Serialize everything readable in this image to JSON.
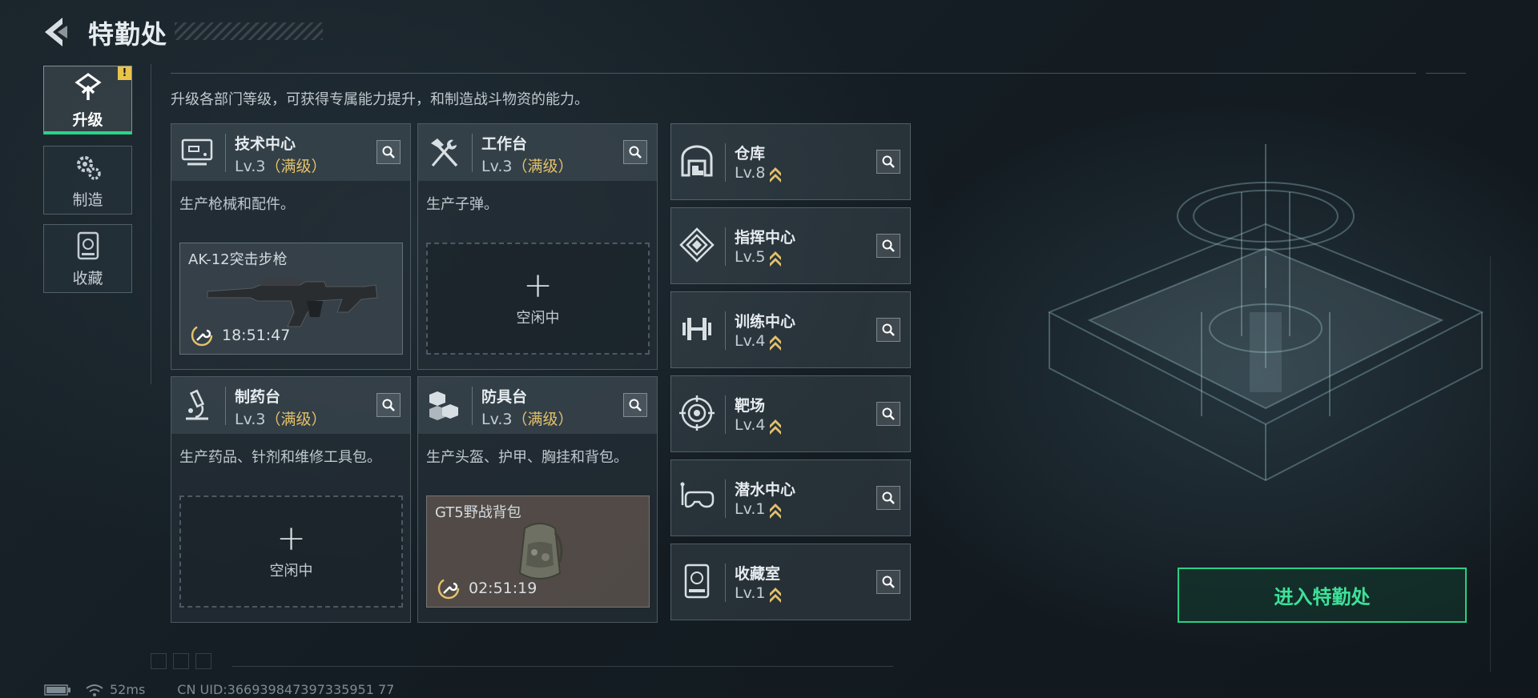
{
  "header": {
    "title": "特勤处"
  },
  "tabs": [
    {
      "label": "升级",
      "icon": "upgrade-icon",
      "active": true,
      "alert": "!"
    },
    {
      "label": "制造",
      "icon": "gear-icon",
      "active": false
    },
    {
      "label": "收藏",
      "icon": "collection-icon",
      "active": false
    }
  ],
  "description": "升级各部门等级，可获得专属能力提升，和制造战斗物资的能力。",
  "facilities": [
    {
      "name": "技术中心",
      "level": "Lv.3",
      "maxed_label": "（满级）",
      "desc": "生产枪械和配件。",
      "slot": {
        "state": "busy",
        "item": "AK-12突击步枪",
        "timer": "18:51:47"
      }
    },
    {
      "name": "工作台",
      "level": "Lv.3",
      "maxed_label": "（满级）",
      "desc": "生产子弹。",
      "slot": {
        "state": "idle",
        "label": "空闲中"
      }
    },
    {
      "name": "制药台",
      "level": "Lv.3",
      "maxed_label": "（满级）",
      "desc": "生产药品、针剂和维修工具包。",
      "slot": {
        "state": "idle",
        "label": "空闲中"
      }
    },
    {
      "name": "防具台",
      "level": "Lv.3",
      "maxed_label": "（满级）",
      "desc": "生产头盔、护甲、胸挂和背包。",
      "slot": {
        "state": "busy",
        "item": "GT5野战背包",
        "timer": "02:51:19"
      }
    }
  ],
  "rooms": [
    {
      "name": "仓库",
      "level": "Lv.8",
      "icon": "warehouse-icon"
    },
    {
      "name": "指挥中心",
      "level": "Lv.5",
      "icon": "command-icon"
    },
    {
      "name": "训练中心",
      "level": "Lv.4",
      "icon": "dumbbell-icon"
    },
    {
      "name": "靶场",
      "level": "Lv.4",
      "icon": "target-icon"
    },
    {
      "name": "潜水中心",
      "level": "Lv.1",
      "icon": "dive-mask-icon"
    },
    {
      "name": "收藏室",
      "level": "Lv.1",
      "icon": "collection-icon"
    }
  ],
  "enter_button": "进入特勤处",
  "footer": {
    "ping": "52ms",
    "uid": "CN UID:366939847397335951 77"
  },
  "colors": {
    "accent": "#2bcf85",
    "maxed": "#e3c16a",
    "alert": "#e8c44a"
  }
}
